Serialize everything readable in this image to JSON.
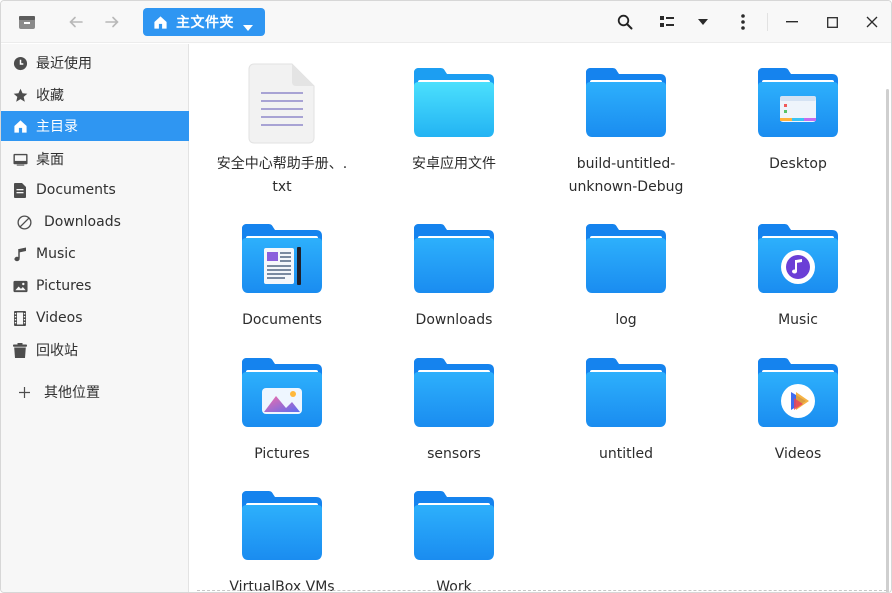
{
  "toolbar": {
    "breadcrumb_label": "主文件夹",
    "icons": {
      "app": "file-manager-icon",
      "back": "arrow-left-icon",
      "forward": "arrow-right-icon",
      "search": "search-icon",
      "view": "icon-view-icon",
      "view_dropdown": "chevron-down-icon",
      "menu": "kebab-menu-icon",
      "minimize": "minimize-icon",
      "maximize": "maximize-icon",
      "close": "close-icon"
    }
  },
  "sidebar": {
    "items": [
      {
        "label": "最近使用",
        "icon": "clock-icon"
      },
      {
        "label": "收藏",
        "icon": "star-icon"
      },
      {
        "label": "主目录",
        "icon": "home-icon",
        "active": true
      },
      {
        "label": "桌面",
        "icon": "desktop-icon"
      },
      {
        "label": "Documents",
        "icon": "document-icon"
      },
      {
        "label": "Downloads",
        "icon": "download-icon"
      },
      {
        "label": "Music",
        "icon": "music-icon"
      },
      {
        "label": "Pictures",
        "icon": "picture-icon"
      },
      {
        "label": "Videos",
        "icon": "video-icon"
      },
      {
        "label": "回收站",
        "icon": "trash-icon"
      },
      {
        "label": "其他位置",
        "icon": "plus-icon"
      }
    ]
  },
  "files": [
    {
      "name": "安全中心帮助手册、.txt",
      "line1": "安全中心帮助手册、.",
      "line2": "txt",
      "type": "text-file"
    },
    {
      "name": "安卓应用文件",
      "line1": "安卓应用文件",
      "line2": "",
      "type": "folder-cyan"
    },
    {
      "name": "build-untitled-unknown-Debug",
      "line1": "build-untitled-",
      "line2": "unknown-Debug",
      "type": "folder"
    },
    {
      "name": "Desktop",
      "line1": "Desktop",
      "line2": "",
      "type": "folder-desktop"
    },
    {
      "name": "Documents",
      "line1": "Documents",
      "line2": "",
      "type": "folder-documents"
    },
    {
      "name": "Downloads",
      "line1": "Downloads",
      "line2": "",
      "type": "folder"
    },
    {
      "name": "log",
      "line1": "log",
      "line2": "",
      "type": "folder"
    },
    {
      "name": "Music",
      "line1": "Music",
      "line2": "",
      "type": "folder-music"
    },
    {
      "name": "Pictures",
      "line1": "Pictures",
      "line2": "",
      "type": "folder-pictures"
    },
    {
      "name": "sensors",
      "line1": "sensors",
      "line2": "",
      "type": "folder"
    },
    {
      "name": "untitled",
      "line1": "untitled",
      "line2": "",
      "type": "folder"
    },
    {
      "name": "Videos",
      "line1": "Videos",
      "line2": "",
      "type": "folder-videos"
    },
    {
      "name": "VirtualBox VMs",
      "line1": "VirtualBox VMs",
      "line2": "",
      "type": "folder"
    },
    {
      "name": "Work",
      "line1": "Work",
      "line2": "",
      "type": "folder"
    }
  ],
  "colors": {
    "accent": "#2f96f2",
    "folder_back": "#1a86ef",
    "folder_front": "#2aa6fb",
    "folder_cyan": "#34cdf8"
  }
}
